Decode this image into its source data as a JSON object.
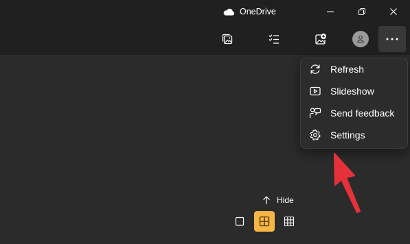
{
  "window": {
    "title": "OneDrive",
    "controls": [
      "minimize-icon",
      "restore-icon",
      "close-icon"
    ]
  },
  "toolbar": {
    "buttons": [
      "slideshow-gallery-icon",
      "select-checklist-icon",
      "add-image-icon",
      "account-avatar",
      "more-options-icon"
    ]
  },
  "menu": {
    "items": [
      {
        "label": "Refresh",
        "icon": "refresh-icon"
      },
      {
        "label": "Slideshow",
        "icon": "slideshow-icon"
      },
      {
        "label": "Send feedback",
        "icon": "feedback-icon"
      },
      {
        "label": "Settings",
        "icon": "gear-icon"
      }
    ]
  },
  "footer": {
    "hide_label": "Hide",
    "view_sizes": [
      "single",
      "medium",
      "small"
    ],
    "active_view": "medium"
  },
  "colors": {
    "background": "#2b2b2b",
    "chrome": "#202020",
    "menu_background": "#2c2c2c",
    "accent": "#f6b644",
    "annotation_arrow": "#e5323a"
  }
}
